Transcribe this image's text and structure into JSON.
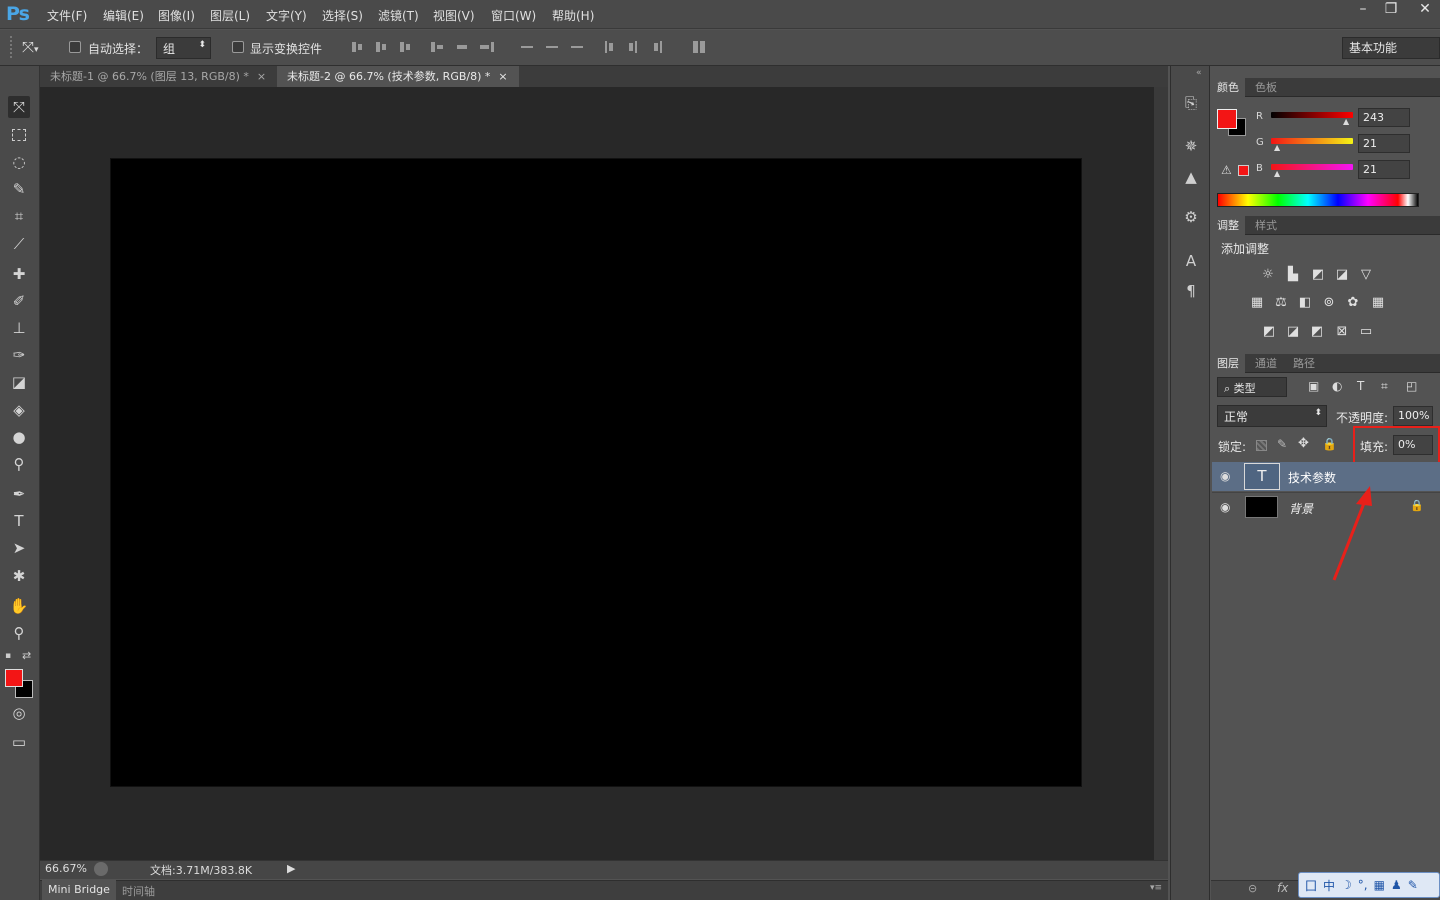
{
  "app": {
    "logo": "Ps"
  },
  "menu": [
    "文件(F)",
    "编辑(E)",
    "图像(I)",
    "图层(L)",
    "文字(Y)",
    "选择(S)",
    "滤镜(T)",
    "视图(V)",
    "窗口(W)",
    "帮助(H)"
  ],
  "window_controls": {
    "minimize": "–",
    "restore": "❐",
    "close": "✕"
  },
  "options_bar": {
    "auto_select_label": "自动选择：",
    "auto_select_value": "组",
    "show_transform_label": "显示变换控件",
    "workspace": "基本功能"
  },
  "tabs": [
    {
      "label": "未标题-1 @ 66.7% (图层 13, RGB/8) *",
      "close": "×"
    },
    {
      "label": "未标题-2 @ 66.7% (技术参数, RGB/8) *",
      "close": "×"
    }
  ],
  "status": {
    "zoom": "66.67%",
    "doc": "文档:3.71M/383.8K",
    "arrow": "▶"
  },
  "bottom_tabs": {
    "mini_bridge": "Mini Bridge",
    "timeline": "时间轴",
    "menu_glyph": "▾≡"
  },
  "color_panel": {
    "tabs": [
      "颜色",
      "色板"
    ],
    "channels": [
      {
        "label": "R",
        "value": "243"
      },
      {
        "label": "G",
        "value": "21"
      },
      {
        "label": "B",
        "value": "21"
      }
    ],
    "foreground": "#f31515",
    "background": "#000000",
    "warning_glyph": "⚠"
  },
  "adjust_panel": {
    "tabs": [
      "调整",
      "样式"
    ],
    "title": "添加调整"
  },
  "layers_panel": {
    "tabs": [
      "图层",
      "通道",
      "路径"
    ],
    "filter_label": "⌕ 类型",
    "filter_icons": [
      "▣",
      "◐",
      "T",
      "⌗",
      "◰"
    ],
    "blend_mode": "正常",
    "opacity_label": "不透明度:",
    "opacity_value": "100%",
    "lock_label": "锁定:",
    "fill_label": "填充:",
    "fill_value": "0%",
    "layers": [
      {
        "name": "技术参数",
        "thumb": "T",
        "selected": true
      },
      {
        "name": "背景",
        "thumb": "",
        "locked": true,
        "selected": false
      }
    ],
    "bottom_link": "⊝",
    "bottom_fx": "fx"
  },
  "ime_bar": {
    "items": [
      "囗",
      "中",
      "☽",
      "°,",
      "▦",
      "♟",
      "✎"
    ]
  },
  "annotation_color": "#e8201a"
}
